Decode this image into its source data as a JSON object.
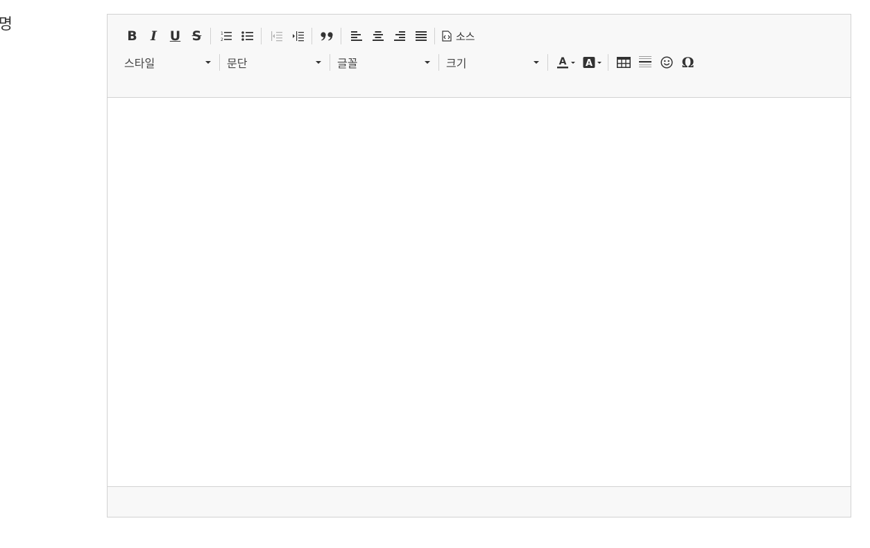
{
  "field_label": "설명",
  "toolbar": {
    "bold": "B",
    "italic": "I",
    "underline": "U",
    "strike": "S",
    "source_label": "소스",
    "style_combo": "스타일",
    "format_combo": "문단",
    "font_combo": "글꼴",
    "size_combo": "크기",
    "special_char": "Ω",
    "text_color_letter": "A",
    "bg_color_letter": "A"
  },
  "colors": {
    "toolbar_bg": "#f8f8f8",
    "border": "#d1d1d1",
    "icon": "#333333"
  }
}
